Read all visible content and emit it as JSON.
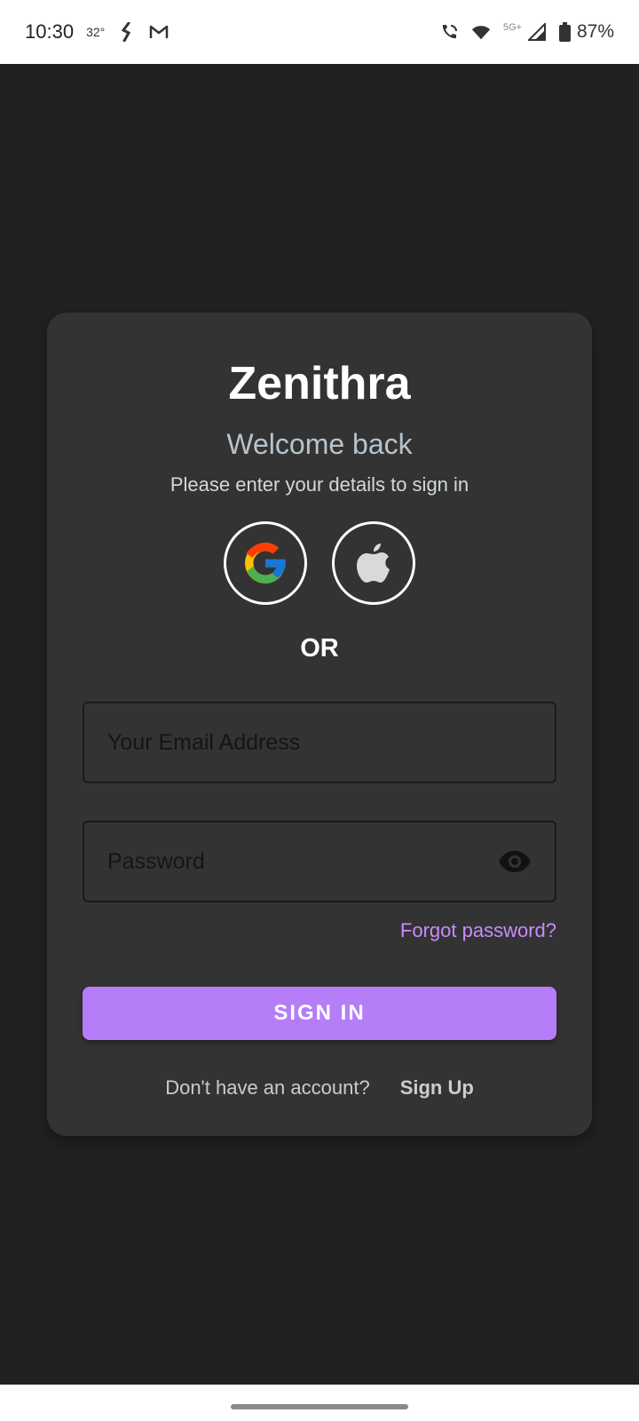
{
  "status_bar": {
    "time": "10:30",
    "temperature": "32°",
    "network_label": "5G+",
    "battery": "87%",
    "icons": [
      "hike-icon",
      "gmail-icon",
      "wifi-call-icon",
      "wifi-icon",
      "signal-icon",
      "battery-icon"
    ]
  },
  "card": {
    "brand": "Zenithra",
    "welcome": "Welcome back",
    "subtitle": "Please enter your details to sign in",
    "social_icons": [
      "google-icon",
      "apple-icon"
    ],
    "or_label": "OR",
    "email_placeholder": "Your Email Address",
    "password_placeholder": "Password",
    "forgot_password": "Forgot password?",
    "sign_in": "SIGN IN",
    "signup_prompt": "Don't have an account?",
    "signup_link": "Sign Up"
  },
  "colors": {
    "background": "#212121",
    "card": "#333333",
    "accent": "#b57ef8",
    "link": "#c98bff"
  }
}
